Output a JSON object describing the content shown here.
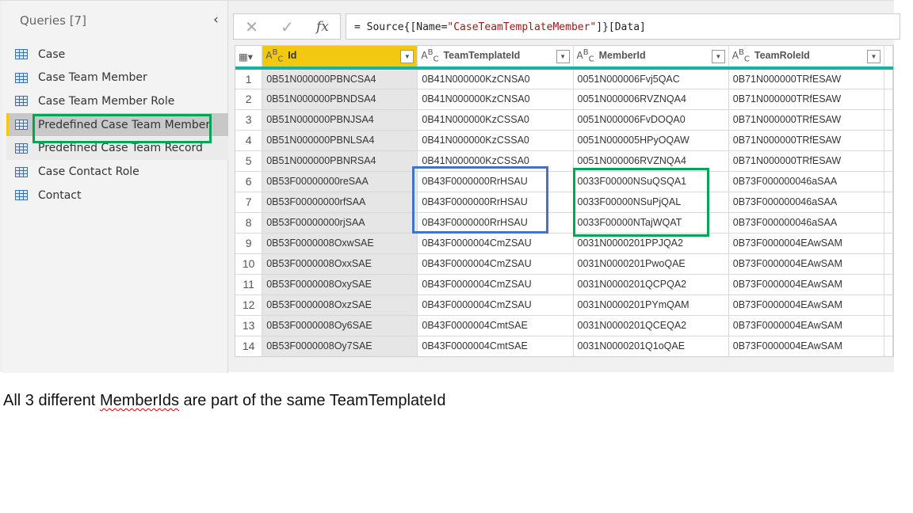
{
  "sidebar": {
    "title": "Queries [7]",
    "items": [
      {
        "label": "Case"
      },
      {
        "label": "Case Team Member"
      },
      {
        "label": "Case Team Member Role"
      },
      {
        "label": "Predefined Case Team Member",
        "selected": true
      },
      {
        "label": "Predefined Case Team Record"
      },
      {
        "label": "Case Contact Role"
      },
      {
        "label": "Contact"
      }
    ]
  },
  "formula_bar": {
    "prefix": "= Source{[Name=",
    "string": "\"CaseTeamTemplateMember\"",
    "suffix": "]}[Data]",
    "fx": "fx"
  },
  "table": {
    "type_icon": "ABC",
    "columns": [
      "Id",
      "TeamTemplateId",
      "MemberId",
      "TeamRoleId"
    ],
    "rows": [
      [
        "1",
        "0B51N000000PBNCSA4",
        "0B41N000000KzCNSA0",
        "0051N000006Fvj5QAC",
        "0B71N000000TRfESAW"
      ],
      [
        "2",
        "0B51N000000PBNDSA4",
        "0B41N000000KzCNSA0",
        "0051N000006RVZNQA4",
        "0B71N000000TRfESAW"
      ],
      [
        "3",
        "0B51N000000PBNJSA4",
        "0B41N000000KzCSSA0",
        "0051N000006FvDOQA0",
        "0B71N000000TRfESAW"
      ],
      [
        "4",
        "0B51N000000PBNLSA4",
        "0B41N000000KzCSSA0",
        "0051N000005HPyOQAW",
        "0B71N000000TRfESAW"
      ],
      [
        "5",
        "0B51N000000PBNRSA4",
        "0B41N000000KzCSSA0",
        "0051N000006RVZNQA4",
        "0B71N000000TRfESAW"
      ],
      [
        "6",
        "0B53F00000000reSAA",
        "0B43F0000000RrHSAU",
        "0033F00000NSuQSQA1",
        "0B73F000000046aSAA"
      ],
      [
        "7",
        "0B53F00000000rfSAA",
        "0B43F0000000RrHSAU",
        "0033F00000NSuPjQAL",
        "0B73F000000046aSAA"
      ],
      [
        "8",
        "0B53F00000000rjSAA",
        "0B43F0000000RrHSAU",
        "0033F00000NTajWQAT",
        "0B73F000000046aSAA"
      ],
      [
        "9",
        "0B53F0000008OxwSAE",
        "0B43F0000004CmZSAU",
        "0031N0000201PPJQA2",
        "0B73F0000004EAwSAM"
      ],
      [
        "10",
        "0B53F0000008OxxSAE",
        "0B43F0000004CmZSAU",
        "0031N0000201PwoQAE",
        "0B73F0000004EAwSAM"
      ],
      [
        "11",
        "0B53F0000008OxySAE",
        "0B43F0000004CmZSAU",
        "0031N0000201QCPQA2",
        "0B73F0000004EAwSAM"
      ],
      [
        "12",
        "0B53F0000008OxzSAE",
        "0B43F0000004CmZSAU",
        "0031N0000201PYmQAM",
        "0B73F0000004EAwSAM"
      ],
      [
        "13",
        "0B53F0000008Oy6SAE",
        "0B43F0000004CmtSAE",
        "0031N0000201QCEQA2",
        "0B73F0000004EAwSAM"
      ],
      [
        "14",
        "0B53F0000008Oy7SAE",
        "0B43F0000004CmtSAE",
        "0031N0000201Q1oQAE",
        "0B73F0000004EAwSAM"
      ]
    ]
  },
  "highlights": {
    "team_template_box_color": "#4472c4",
    "member_box_color": "#00a651",
    "sidebar_box_color": "#00a651"
  },
  "note": {
    "before": "All 3 different ",
    "squiggle": "MemberIds",
    "after": " are part of the same TeamTemplateId"
  }
}
